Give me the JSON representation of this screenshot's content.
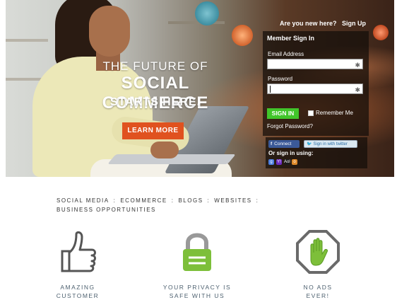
{
  "hero": {
    "headline_1": "THE FUTURE OF",
    "headline_2": "SOCIAL COMMERCE",
    "headline_3": "STARTS HERE.",
    "learn_more_label": "LEARN MORE"
  },
  "signup": {
    "question": "Are you new here?",
    "link": "Sign Up"
  },
  "login": {
    "title": "Member Sign In",
    "email_label": "Email Address",
    "email_value": "",
    "password_label": "Password",
    "password_value": "",
    "signin_label": "SIGN IN",
    "remember_label": "Remember Me",
    "remember_checked": false,
    "forgot_label": "Forgot Password?",
    "facebook_label": "Connect",
    "twitter_label": "Sign in with twitter",
    "or_label": "Or sign in using:",
    "providers": [
      {
        "name": "google-icon",
        "glyph": "g",
        "color": "#4a7de0"
      },
      {
        "name": "yahoo-icon",
        "glyph": "Y!",
        "color": "#6b2bbf"
      },
      {
        "name": "aol-icon",
        "glyph": "Aol",
        "color": "#1b1b1b"
      },
      {
        "name": "openid-icon",
        "glyph": "o",
        "color": "#e08a2a"
      }
    ]
  },
  "tags": {
    "line1": [
      "SOCIAL MEDIA",
      "ECOMMERCE",
      "BLOGS",
      "WEBSITES"
    ],
    "separator": ":",
    "line2": "BUSINESS OPPORTUNITIES"
  },
  "features": [
    {
      "icon": "thumbs-up-icon",
      "caption": "AMAZING",
      "caption_2": "CUSTOMER",
      "color": "#555555"
    },
    {
      "icon": "padlock-icon",
      "caption": "YOUR PRIVACY IS",
      "caption_2": "SAFE WITH US",
      "color": "#7dbf3a"
    },
    {
      "icon": "stop-hand-icon",
      "caption": "NO ADS",
      "caption_2": "EVER!",
      "color": "#6a6a6a"
    }
  ],
  "colors": {
    "learn_more": "#e0521f",
    "signin": "#41c52a",
    "facebook": "#3b5998",
    "caption_text": "#4e6170"
  }
}
